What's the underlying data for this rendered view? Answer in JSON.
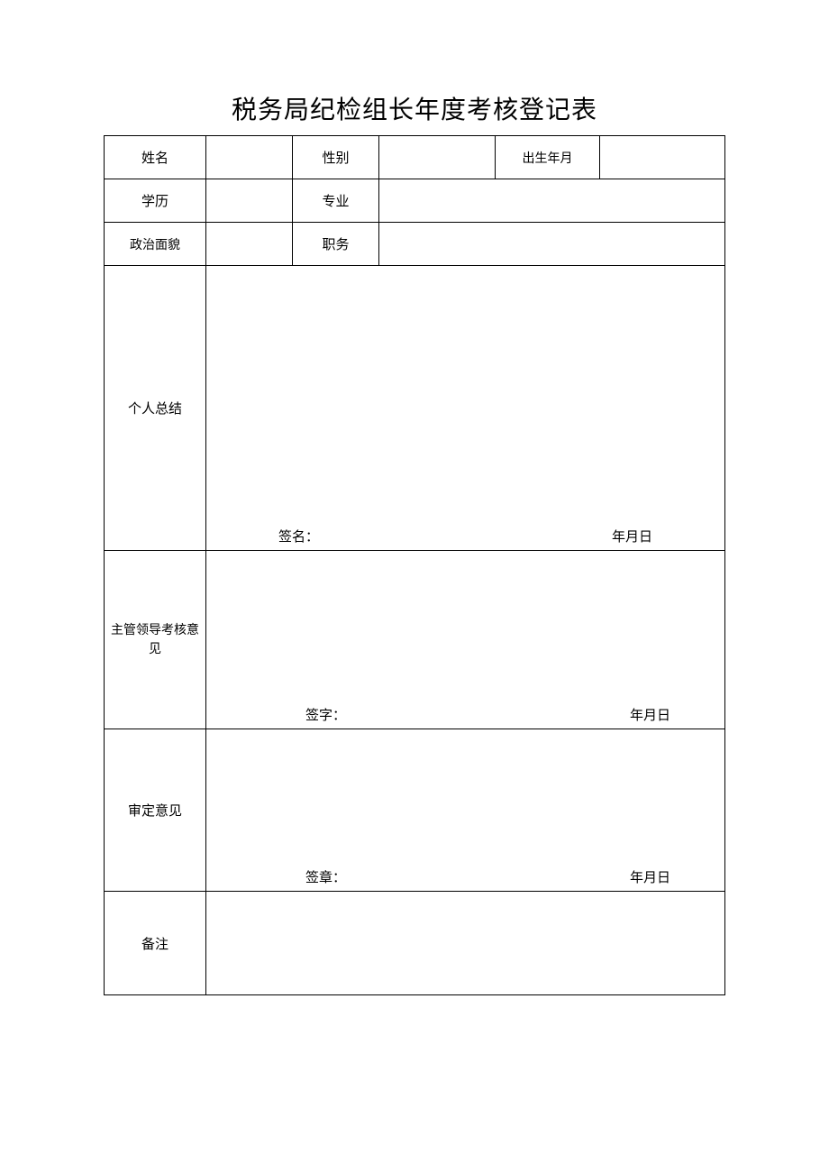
{
  "title": "税务局纪检组长年度考核登记表",
  "labels": {
    "name": "姓名",
    "gender": "性别",
    "birth": "出生年月",
    "education": "学历",
    "major": "专业",
    "political": "政治面貌",
    "position": "职务",
    "summary": "个人总结",
    "supervisor": "主管领导考核意见",
    "approval": "审定意见",
    "remarks": "备注"
  },
  "sign": {
    "signature_label": "签名：",
    "sign_label": "签字：",
    "seal_label": "签章：",
    "date_label_short": "年月日",
    "date_label": "年月日"
  },
  "values": {
    "name": "",
    "gender": "",
    "birth": "",
    "education": "",
    "major": "",
    "political": "",
    "position": ""
  }
}
